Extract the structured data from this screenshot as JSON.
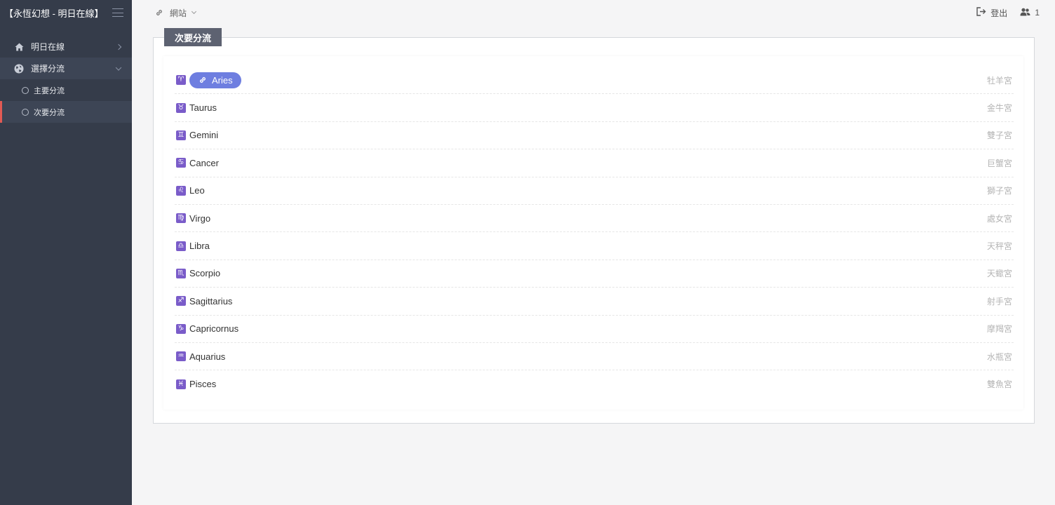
{
  "app": {
    "title": "【永恆幻想 - 明日在線】"
  },
  "sidebar": {
    "items": [
      {
        "label": "明日在線",
        "icon": "home-icon"
      },
      {
        "label": "選擇分流",
        "icon": "globe-icon"
      }
    ],
    "subitems": [
      {
        "label": "主要分流"
      },
      {
        "label": "次要分流"
      }
    ]
  },
  "topbar": {
    "crumb_label": "網站",
    "logout_label": "登出",
    "users_count": "1"
  },
  "panel": {
    "tab_label": "次要分流"
  },
  "colors": {
    "sidebar_bg": "#353c4a",
    "accent_active": "#e25a54",
    "pill_bg": "#6e7ee0",
    "sign_bg": "#7a5cc9"
  },
  "zodiac": [
    {
      "sign": "♈",
      "name": "Aries",
      "cn": "牡羊宮"
    },
    {
      "sign": "♉",
      "name": "Taurus",
      "cn": "金牛宮"
    },
    {
      "sign": "♊",
      "name": "Gemini",
      "cn": "雙子宮"
    },
    {
      "sign": "♋",
      "name": "Cancer",
      "cn": "巨蟹宮"
    },
    {
      "sign": "♌",
      "name": "Leo",
      "cn": "獅子宮"
    },
    {
      "sign": "♍",
      "name": "Virgo",
      "cn": "處女宮"
    },
    {
      "sign": "♎",
      "name": "Libra",
      "cn": "天秤宮"
    },
    {
      "sign": "♏",
      "name": "Scorpio",
      "cn": "天蠍宮"
    },
    {
      "sign": "♐",
      "name": "Sagittarius",
      "cn": "射手宮"
    },
    {
      "sign": "♑",
      "name": "Capricornus",
      "cn": "摩羯宮"
    },
    {
      "sign": "♒",
      "name": "Aquarius",
      "cn": "水瓶宮"
    },
    {
      "sign": "♓",
      "name": "Pisces",
      "cn": "雙魚宮"
    }
  ]
}
